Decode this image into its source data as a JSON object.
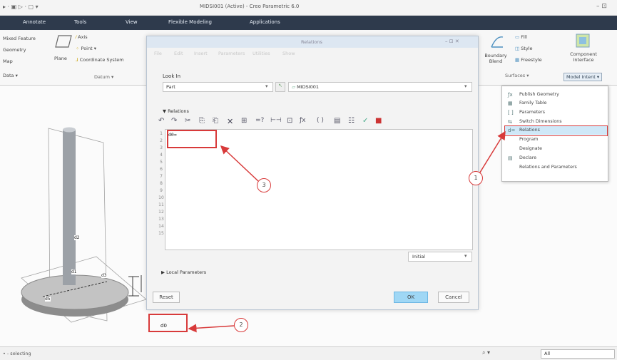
{
  "window": {
    "qat": "▸ · ▣ ▷ · ▢ ▾",
    "title": "MIDSI001 (Active) - Creo Parametric 6.0",
    "controls": "–  ⊡"
  },
  "ribbon_tabs": [
    "Annotate",
    "Tools",
    "View",
    "Flexible Modeling",
    "Applications"
  ],
  "ribbon": {
    "left_items": [
      "Mixed Feature",
      "Geometry",
      "Map",
      "Data ▾"
    ],
    "plane_label": "Plane",
    "datum_items": [
      "Axis",
      "Point ▾",
      "Coordinate System"
    ],
    "datum_group": "Datum ▾",
    "surfaces": {
      "boundary_blend": "Boundary Blend",
      "items": [
        "Fill",
        "Style",
        "Freestyle"
      ],
      "group": "Surfaces ▾"
    },
    "component_interface": "Component Interface",
    "model_intent": "Model Intent ▾"
  },
  "dialog": {
    "title": "Relations",
    "controls": "–  ⊡  ✕",
    "menu": [
      "File",
      "Edit",
      "Insert",
      "Parameters",
      "Utilities",
      "Show"
    ],
    "look_in_label": "Look In",
    "look_in_type": "Part",
    "look_in_model": "MIDSI001",
    "relations_label": "Relations",
    "toolbar_glyphs": [
      "↶",
      "↷",
      "✂",
      "⎘",
      "⎗",
      "✕",
      "⊞",
      "=?",
      "⊢⊣",
      "⊡",
      "ƒx",
      "( )",
      "▤",
      "☷",
      "✓",
      "■"
    ],
    "editor_first_line": "d0=",
    "line_numbers": [
      "1",
      "2",
      "3",
      "4",
      "5",
      "6",
      "7",
      "8",
      "9",
      "10",
      "11",
      "12",
      "13",
      "14",
      "15"
    ],
    "units": "Initial",
    "local_params_label": "Local Parameters",
    "reset_label": "Reset",
    "ok_label": "OK",
    "cancel_label": "Cancel"
  },
  "model_intent_menu": [
    {
      "icon": "ƒx",
      "label": "Publish Geometry"
    },
    {
      "icon": "▦",
      "label": "Family Table"
    },
    {
      "icon": "[ ]",
      "label": "Parameters"
    },
    {
      "icon": "⇆",
      "label": "Switch Dimensions"
    },
    {
      "icon": "d=",
      "label": "Relations"
    },
    {
      "icon": "",
      "label": "Program"
    },
    {
      "icon": "",
      "label": "Designate"
    },
    {
      "icon": "▤",
      "label": "Declare"
    },
    {
      "icon": "",
      "label": "Relations and Parameters"
    }
  ],
  "model": {
    "dim_labels": [
      "d2",
      "d1",
      "d0",
      "d3",
      "d5"
    ],
    "selected_dim": "d0"
  },
  "callouts": [
    "1",
    "2",
    "3"
  ],
  "status": {
    "left": "• - selecting",
    "filter": "All",
    "search": "⌕ ▾"
  },
  "colors": {
    "accent_red": "#d83a3a",
    "ribbon_dark": "#2e3a4c",
    "highlight": "#cfe8f8"
  }
}
